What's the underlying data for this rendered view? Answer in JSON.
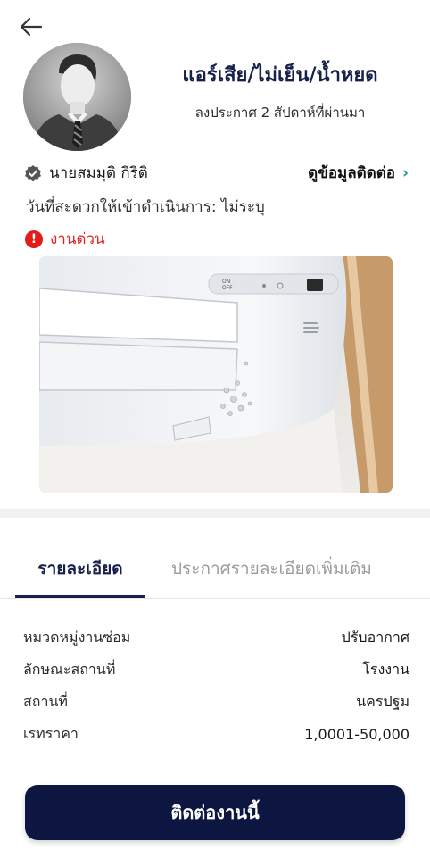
{
  "header": {
    "title": "แอร์เสีย/ไม่เย็น/น้ำหยด",
    "posted": "ลงประกาศ 2 สัปดาห์ที่ผ่านมา"
  },
  "owner": {
    "name": "นายสมมุติ กิริติ",
    "contact_label": "ดูข้อมูลติดต่อ"
  },
  "date_line": "วันที่สะดวกให้เข้าดำเนินการ: ไม่ระบุ",
  "urgent_label": "งานด่วน",
  "tabs": [
    {
      "label": "รายละเอียด",
      "active": true
    },
    {
      "label": "ประกาศรายละเอียดเพิ่มเติม",
      "active": false
    }
  ],
  "details": [
    {
      "key": "หมวดหมู่งานซ่อม",
      "value": "ปรับอากาศ"
    },
    {
      "key": "ลักษณะสถานที่",
      "value": "โรงงาน"
    },
    {
      "key": "สถานที่",
      "value": "นครปฐม"
    },
    {
      "key": "เรทราคา",
      "value": "1,0001-50,000"
    }
  ],
  "cta_label": "ติดต่องานนี้",
  "colors": {
    "navy": "#0d1640",
    "urgent": "#e41b1b",
    "teal": "#1c9b8f"
  }
}
